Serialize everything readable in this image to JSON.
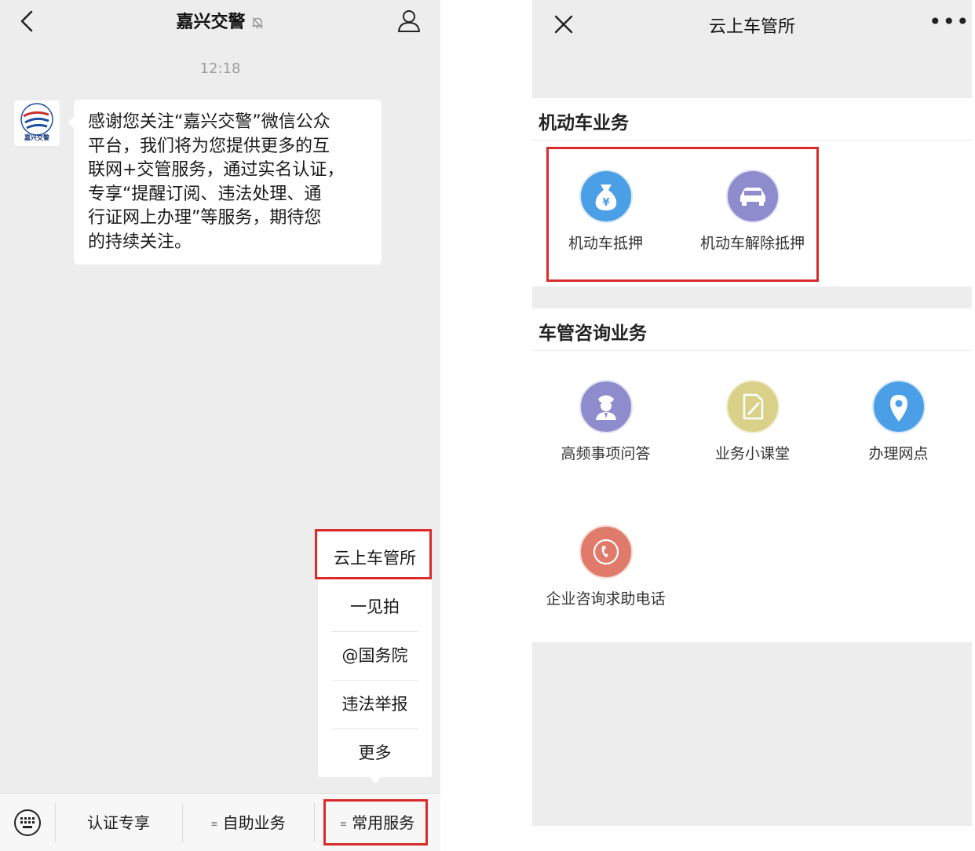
{
  "chat": {
    "title": "嘉兴交警",
    "time": "12:18",
    "avatar_caption": "嘉兴交警",
    "message_lines": [
      "感谢您关注“嘉兴交警”微信公众",
      "平台，我们将为您提供更多的互",
      "联网+交管服务，通过实名认证，",
      "专享“提醒订阅、违法处理、通",
      "行证网上办理”等服务，期待您",
      "的持续关注。"
    ],
    "popup_menu": [
      "云上车管所",
      "一见拍",
      "@国务院",
      "违法举报",
      "更多"
    ],
    "bottom_menu": [
      "认证专享",
      "自助业务",
      "常用服务"
    ]
  },
  "webpage": {
    "title": "云上车管所",
    "more": "•••",
    "sections": [
      {
        "title": "机动车业务",
        "items": [
          {
            "label": "机动车抵押",
            "icon": "money-bag-icon",
            "color": "#4a9fe6"
          },
          {
            "label": "机动车解除抵押",
            "icon": "car-icon",
            "color": "#8e8ccc"
          }
        ]
      },
      {
        "title": "车管咨询业务",
        "items": [
          {
            "label": "高频事项问答",
            "icon": "officer-icon",
            "color": "#8e8ccc"
          },
          {
            "label": "业务小课堂",
            "icon": "document-edit-icon",
            "color": "#d9d08a"
          },
          {
            "label": "办理网点",
            "icon": "location-pin-icon",
            "color": "#4a9fe6"
          },
          {
            "label": "企业咨询求助电话",
            "icon": "phone-icon",
            "color": "#e07a6a"
          }
        ]
      }
    ]
  },
  "colors": {
    "highlight": "#d92b2b",
    "chat_bg": "#ededed",
    "bubble_bg": "#ffffff"
  }
}
